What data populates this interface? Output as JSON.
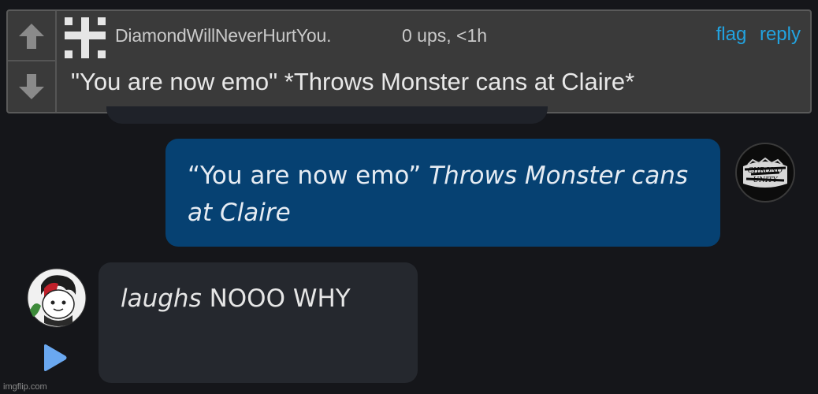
{
  "comment": {
    "username": "DiamondWillNeverHurtYou.",
    "meta": "0 ups, <1h",
    "flag_label": "flag",
    "reply_label": "reply",
    "text": "\"You are now emo\" *Throws Monster cans at Claire*",
    "icons": {
      "upvote": "arrow-up-icon",
      "downvote": "arrow-down-icon",
      "avatar": "pixel-cross-avatar"
    }
  },
  "chat": {
    "outgoing": {
      "quote": "“You are now emo”",
      "action": "Throws Monster cans at Claire",
      "avatar_icon": "chrono-unity-avatar",
      "avatar_text": "CHRONO UNITY"
    },
    "incoming": {
      "action": "laughs",
      "text": "NOOO WHY",
      "avatar_icon": "character-avatar"
    },
    "play_icon": "play-triangle-icon"
  },
  "watermark": "imgflip.com",
  "colors": {
    "background": "#15161a",
    "card": "#3a3a3a",
    "link": "#22a3e0",
    "outgoing_bubble": "#064172",
    "incoming_bubble": "#25282e",
    "play": "#6aa8f0"
  }
}
